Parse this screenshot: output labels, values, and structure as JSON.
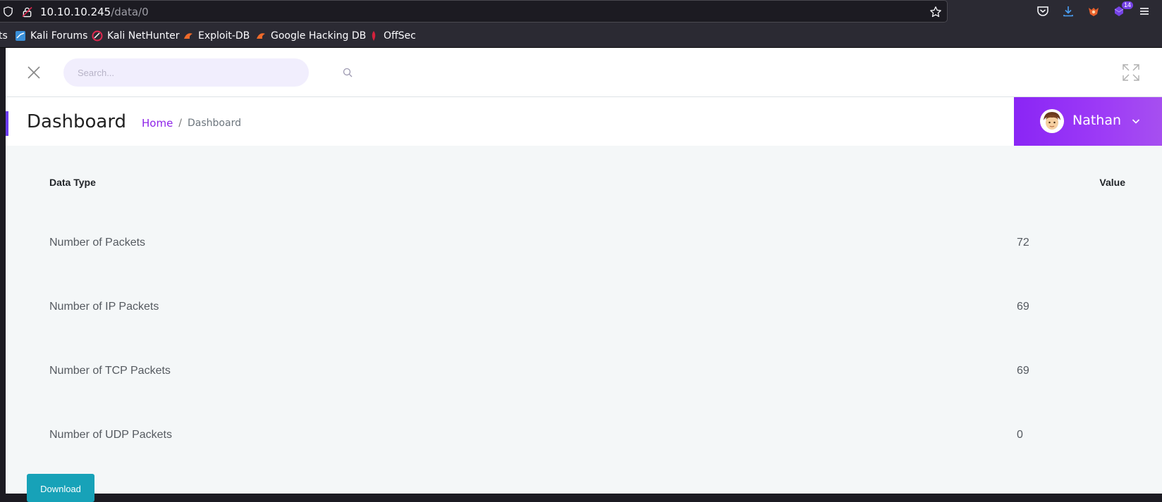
{
  "browser": {
    "url_host": "10.10.10.245",
    "url_path": "/data/0",
    "badge_count": "14",
    "bookmarks": [
      {
        "label": "ts",
        "icon": "kali-icon"
      },
      {
        "label": "Kali Forums",
        "icon": "kali-forums-icon"
      },
      {
        "label": "Kali NetHunter",
        "icon": "nethunter-icon"
      },
      {
        "label": "Exploit-DB",
        "icon": "exploitdb-icon"
      },
      {
        "label": "Google Hacking DB",
        "icon": "ghdb-icon"
      },
      {
        "label": "OffSec",
        "icon": "offsec-icon"
      }
    ]
  },
  "topbar": {
    "search_placeholder": "Search..."
  },
  "header": {
    "title": "Dashboard",
    "breadcrumb_home": "Home",
    "breadcrumb_sep": "/",
    "breadcrumb_current": "Dashboard",
    "user_name": "Nathan"
  },
  "table": {
    "columns": [
      "Data Type",
      "Value"
    ],
    "rows": [
      {
        "type": "Number of Packets",
        "value": "72"
      },
      {
        "type": "Number of IP Packets",
        "value": "69"
      },
      {
        "type": "Number of TCP Packets",
        "value": "69"
      },
      {
        "type": "Number of UDP Packets",
        "value": "0"
      }
    ]
  },
  "actions": {
    "download_label": "Download"
  },
  "colors": {
    "accent": "#8a25f5",
    "breadcrumb_link": "#8e24e8",
    "download_button": "#17a2b8",
    "search_bg": "#f1eefd",
    "page_bg": "#f4f7f8"
  }
}
